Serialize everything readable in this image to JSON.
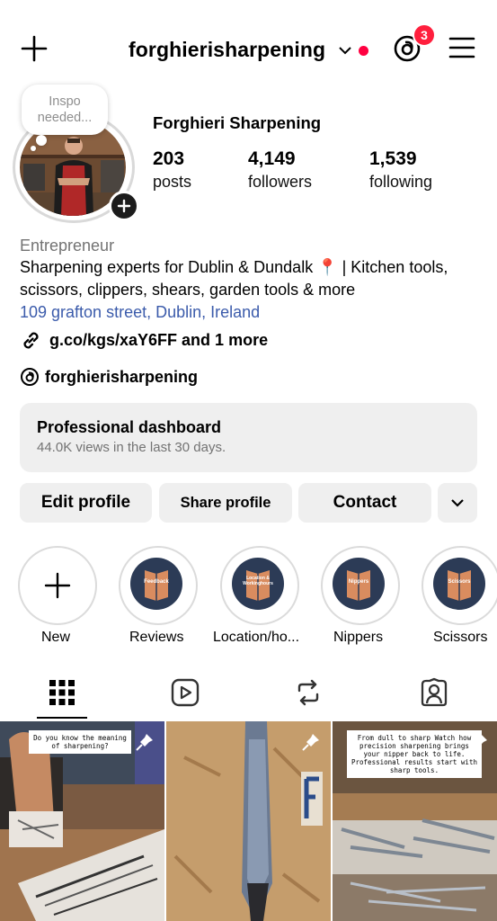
{
  "header": {
    "username": "forghierisharpening",
    "notification_count": "3",
    "icons": [
      "plus-icon",
      "chevron-down-icon",
      "threads-icon",
      "hamburger-menu-icon"
    ],
    "notification_dot_color": "#ff0040"
  },
  "profile": {
    "note": "Inspo needed...",
    "full_name": "Forghieri Sharpening",
    "stats": {
      "posts": {
        "value": "203",
        "label": "posts"
      },
      "followers": {
        "value": "4,149",
        "label": "followers"
      },
      "following": {
        "value": "1,539",
        "label": "following"
      }
    }
  },
  "bio": {
    "category": "Entrepreneur",
    "text": "Sharpening experts for Dublin & Dundalk 📍 | Kitchen tools, scissors, clippers, shears, garden tools & more",
    "address": "109 grafton street, Dublin, Ireland",
    "link": "g.co/kgs/xaY6FF and 1 more",
    "threads_handle": "forghierisharpening"
  },
  "dashboard": {
    "title": "Professional dashboard",
    "subtitle": "44.0K views in the last 30 days."
  },
  "buttons": {
    "edit": "Edit profile",
    "share": "Share profile",
    "contact": "Contact"
  },
  "highlights": [
    {
      "label": "New",
      "cover_text": ""
    },
    {
      "label": "Reviews",
      "cover_text": "Feedback"
    },
    {
      "label": "Location/ho...",
      "cover_text": "Location & Workinghours"
    },
    {
      "label": "Nippers",
      "cover_text": "Nippers"
    },
    {
      "label": "Scissors",
      "cover_text": "Scissors"
    }
  ],
  "tabs": [
    "grid-icon",
    "reels-icon",
    "reposts-icon",
    "tagged-icon"
  ],
  "posts": [
    {
      "caption": "Do you know the meaning of sharpening?",
      "pinned": true
    },
    {
      "caption": "",
      "pinned": true
    },
    {
      "caption": "From dull to sharp Watch how precision sharpening brings your nipper back to life. Professional results start with sharp tools.",
      "pinned": true
    }
  ],
  "colors": {
    "link": "#3b5bab",
    "badge": "#ff1f3d",
    "highlight_cover": "#2c3b56"
  }
}
